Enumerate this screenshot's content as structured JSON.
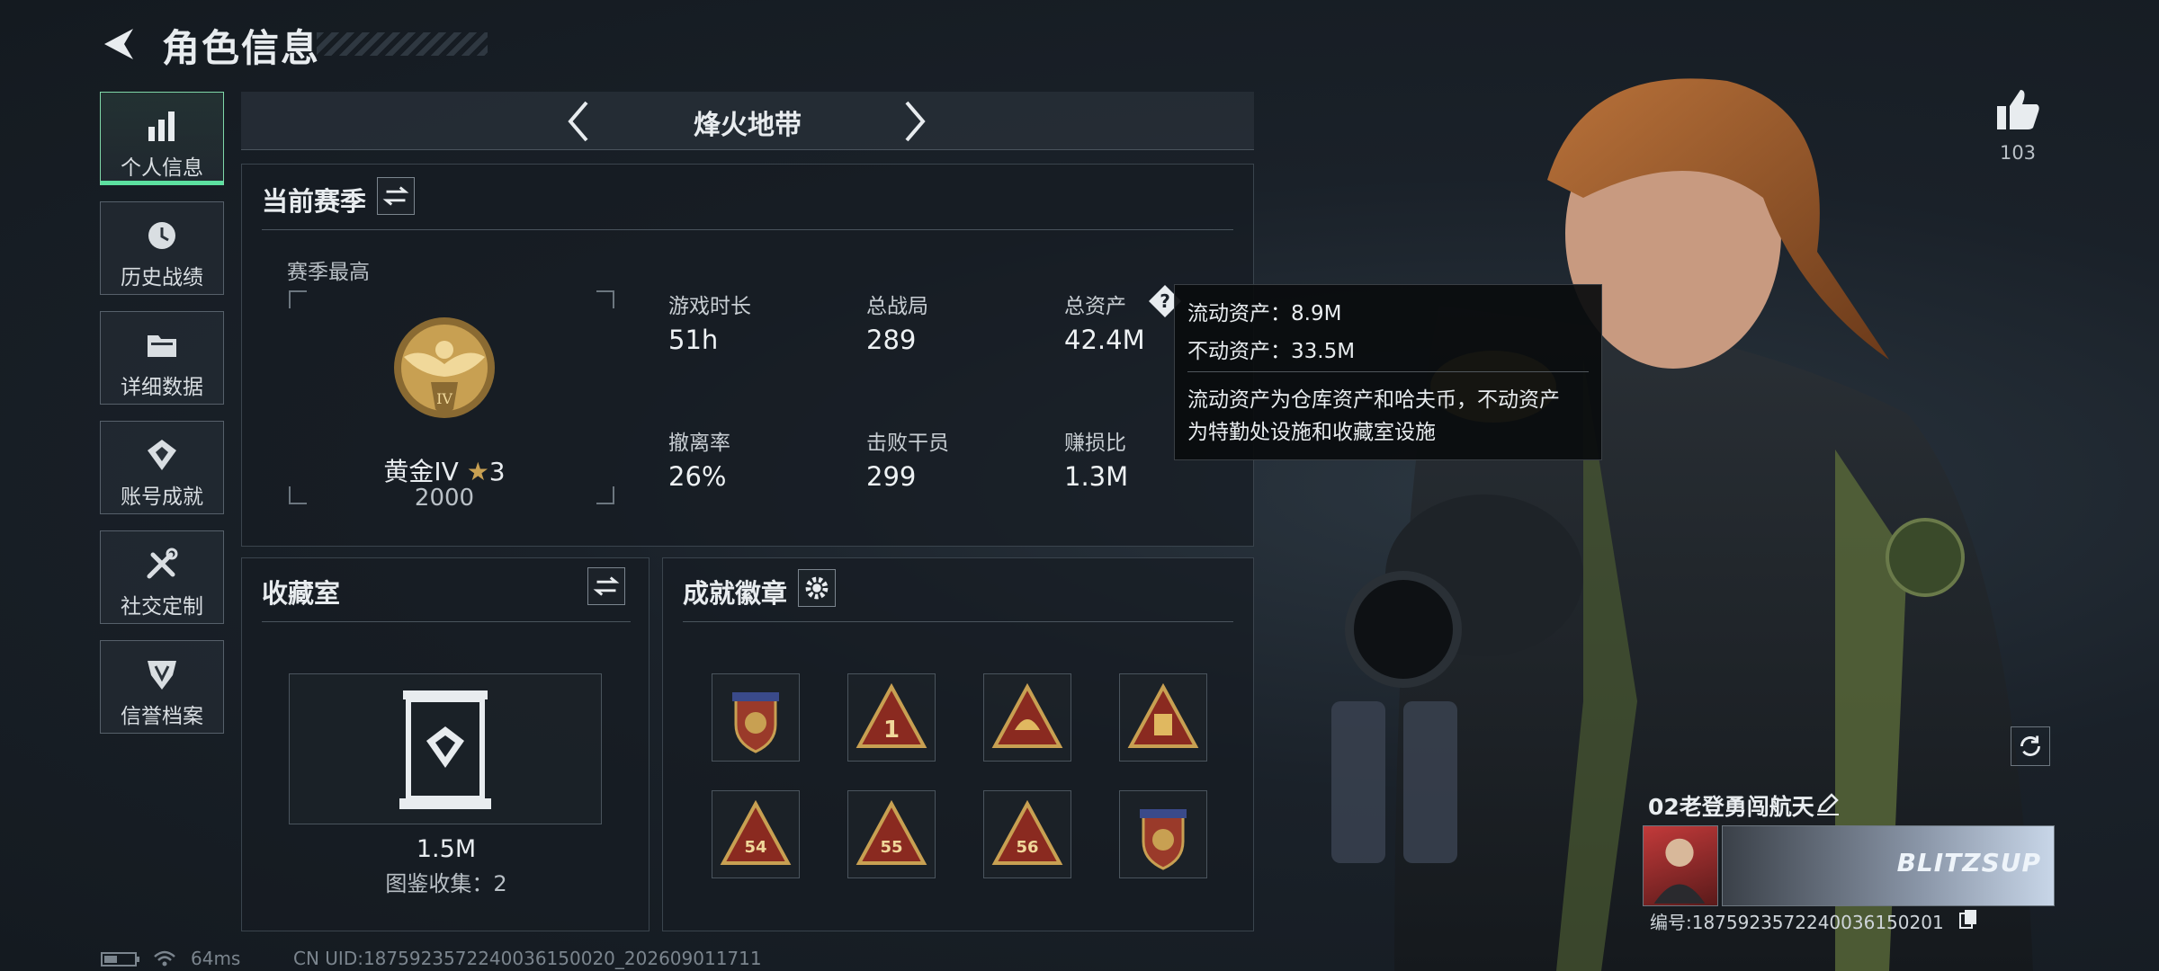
{
  "header": {
    "title": "角色信息"
  },
  "nav": {
    "items": [
      {
        "label": "个人信息",
        "icon": "bar-chart-icon",
        "active": true
      },
      {
        "label": "历史战绩",
        "icon": "clock-history-icon"
      },
      {
        "label": "详细数据",
        "icon": "folder-icon"
      },
      {
        "label": "账号成就",
        "icon": "achievement-icon"
      },
      {
        "label": "社交定制",
        "icon": "tools-icon"
      },
      {
        "label": "信誉档案",
        "icon": "credit-shield-icon"
      }
    ]
  },
  "mode": {
    "name": "烽火地带"
  },
  "season": {
    "title": "当前赛季",
    "best_label": "赛季最高",
    "rank_name": "黄金IV",
    "rank_stars": "3",
    "rank_points": "2000",
    "rank_emblem_numeral": "IV",
    "stats": [
      {
        "label": "游戏时长",
        "value": "51h"
      },
      {
        "label": "总战局",
        "value": "289"
      },
      {
        "label": "总资产",
        "value": "42.4M"
      },
      {
        "label": "撤离率",
        "value": "26%"
      },
      {
        "label": "击败干员",
        "value": "299"
      },
      {
        "label": "赚损比",
        "value": "1.3M"
      }
    ]
  },
  "tooltip": {
    "liquid": "流动资产：8.9M",
    "fixed": "不动资产：33.5M",
    "desc_line1": "流动资产为仓库资产和哈夫币，不动资产",
    "desc_line2": "为特勤处设施和收藏室设施"
  },
  "collection": {
    "title": "收藏室",
    "value": "1.5M",
    "count_text": "图鉴收集：2"
  },
  "badges": {
    "title": "成就徽章",
    "items": [
      {
        "name": "badge-shield-stars",
        "numeral": ""
      },
      {
        "name": "badge-triangle-1",
        "numeral": "1"
      },
      {
        "name": "badge-triangle-helmet",
        "numeral": ""
      },
      {
        "name": "badge-triangle-card",
        "numeral": ""
      },
      {
        "name": "badge-triangle-54",
        "numeral": "54"
      },
      {
        "name": "badge-triangle-55",
        "numeral": "55"
      },
      {
        "name": "badge-triangle-56",
        "numeral": "56"
      },
      {
        "name": "badge-shield-stars-2",
        "numeral": ""
      }
    ]
  },
  "profile": {
    "likes": "103",
    "player_name": "02老登勇闯航天",
    "id_text": "编号:1875923572240036150201",
    "card_text": "BLITZSUP"
  },
  "footer": {
    "ping": "64ms",
    "uid": "CN UID:1875923572240036150020_202609011711"
  },
  "colors": {
    "accent": "#5ce0a0",
    "gold": "#c8a052",
    "panel_border": "#3a444d"
  }
}
